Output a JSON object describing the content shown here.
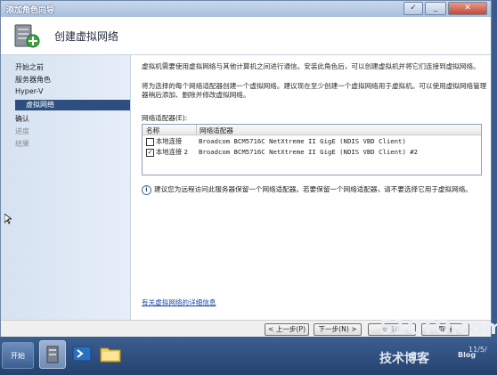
{
  "window": {
    "title": "添加角色向导",
    "header_title": "创建虚拟网络"
  },
  "nav": {
    "items": [
      {
        "label": "开始之前",
        "state": "normal"
      },
      {
        "label": "服务器角色",
        "state": "normal"
      },
      {
        "label": "Hyper-V",
        "state": "normal"
      },
      {
        "label": "虚拟网络",
        "state": "active"
      },
      {
        "label": "确认",
        "state": "normal"
      },
      {
        "label": "进度",
        "state": "dim"
      },
      {
        "label": "结果",
        "state": "dim"
      }
    ]
  },
  "content": {
    "para1": "虚拟机需要使用虚拟网络与其他计算机之间进行通信。安装此角色后，可以创建虚拟机并将它们连接到虚拟网络。",
    "para2": "将为选择的每个网络适配器创建一个虚拟网络。建议现在至少创建一个虚拟网络用于虚拟机。可以使用虚拟网络管理器稍后添加、删除并修改虚拟网络。",
    "grid_label": "网络适配器(E):",
    "columns": [
      "名称",
      "网络适配器"
    ],
    "rows": [
      {
        "name": "本地连接",
        "adapter": "Broadcom BCM5716C NetXtreme II GigE (NDIS VBD Client)",
        "checked": false
      },
      {
        "name": "本地连接 2",
        "adapter": "Broadcom BCM5716C NetXtreme II GigE (NDIS VBD Client) #2",
        "checked": true
      }
    ],
    "info": "建议您为远程访问此服务器保留一个网络适配器。若要保留一个网络适配器，请不要选择它用于虚拟网络。",
    "link": "有关虚拟网络的详细信息"
  },
  "footer": {
    "back": "< 上一步(P)",
    "next": "下一步(N) >",
    "install": "安装(I)",
    "cancel": "取消"
  },
  "taskbar": {
    "start": "开始",
    "clock": "11/5/"
  },
  "watermark": {
    "site": "51CTO.com",
    "blog": "技术博客",
    "blog_sub": "Blog"
  }
}
